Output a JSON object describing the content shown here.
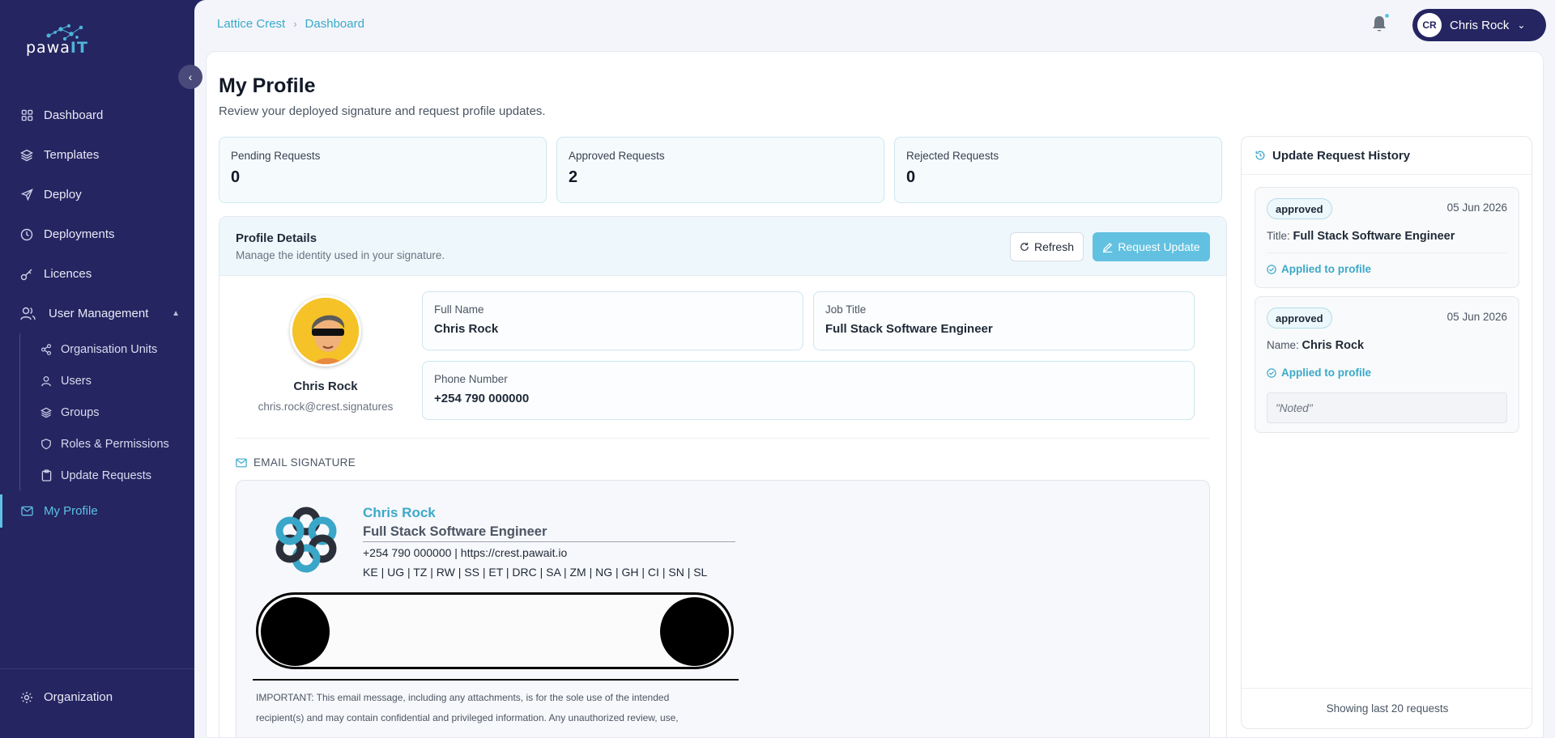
{
  "brand": {
    "logo_part1": "pawa",
    "logo_part2": "IT"
  },
  "sidebar": {
    "items": [
      {
        "label": "Dashboard",
        "icon": "grid-icon"
      },
      {
        "label": "Templates",
        "icon": "layers-icon"
      },
      {
        "label": "Deploy",
        "icon": "send-icon"
      },
      {
        "label": "Deployments",
        "icon": "clock-icon"
      },
      {
        "label": "Licences",
        "icon": "key-icon"
      },
      {
        "label": "User Management",
        "icon": "users-icon"
      }
    ],
    "sub_items": [
      {
        "label": "Organisation Units",
        "icon": "share-icon"
      },
      {
        "label": "Users",
        "icon": "user-icon"
      },
      {
        "label": "Groups",
        "icon": "layers-icon"
      },
      {
        "label": "Roles & Permissions",
        "icon": "shield-icon"
      },
      {
        "label": "Update Requests",
        "icon": "clipboard-icon"
      }
    ],
    "active": {
      "label": "My Profile",
      "icon": "mail-icon"
    },
    "organization": {
      "label": "Organization",
      "icon": "gear-icon"
    }
  },
  "breadcrumb": {
    "root": "Lattice Crest",
    "current": "Dashboard"
  },
  "user": {
    "initials": "CR",
    "name": "Chris Rock"
  },
  "page": {
    "title": "My Profile",
    "subtitle": "Review your deployed signature and request profile updates."
  },
  "stats": [
    {
      "label": "Pending Requests",
      "value": "0"
    },
    {
      "label": "Approved Requests",
      "value": "2"
    },
    {
      "label": "Rejected Requests",
      "value": "0"
    }
  ],
  "profile": {
    "header_title": "Profile Details",
    "header_subtitle": "Manage the identity used in your signature.",
    "refresh_label": "Refresh",
    "request_label": "Request Update",
    "name": "Chris Rock",
    "email": "chris.rock@crest.signatures",
    "fields": {
      "full_name_label": "Full Name",
      "full_name": "Chris Rock",
      "job_title_label": "Job Title",
      "job_title": "Full Stack Software Engineer",
      "phone_label": "Phone Number",
      "phone": "+254 790 000000"
    }
  },
  "signature": {
    "section_title": "EMAIL SIGNATURE",
    "name": "Chris Rock",
    "job": "Full Stack Software Engineer",
    "contact": "+254 790 000000 | https://crest.pawait.io",
    "countries": "KE | UG | TZ | RW | SS | ET | DRC | SA | ZM | NG | GH | CI | SN | SL",
    "disclaimer": "IMPORTANT: This email message, including any attachments, is for the sole use of the intended recipient(s) and may contain confidential and privileged information. Any unauthorized review, use,"
  },
  "history": {
    "title": "Update Request History",
    "requests": [
      {
        "status": "approved",
        "date": "05 Jun 2026",
        "field_label": "Title:",
        "field_value": "Full Stack Software Engineer",
        "applied": "Applied to profile"
      },
      {
        "status": "approved",
        "date": "05 Jun 2026",
        "field_label": "Name:",
        "field_value": "Chris Rock",
        "applied": "Applied to profile",
        "note": "\"Noted\""
      }
    ],
    "footer": "Showing last 20 requests"
  },
  "colors": {
    "sidebar_bg": "#252561",
    "accent": "#5ec1e3",
    "link": "#3ba9c9"
  }
}
